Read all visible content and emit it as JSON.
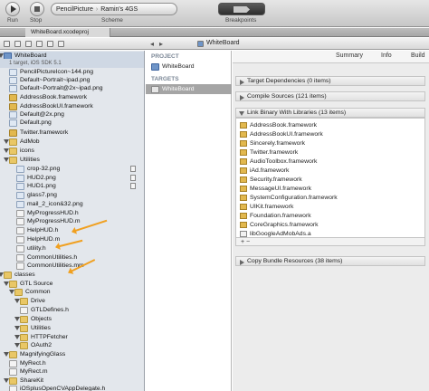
{
  "toolbar": {
    "run_label": "Run",
    "stop_label": "Stop",
    "scheme_target": "PencilPicture",
    "scheme_device": "Ramin's 4GS",
    "scheme_label": "Scheme",
    "breakpoints_label": "Breakpoints"
  },
  "tab": {
    "title": "WhiteBoard.xcodeproj"
  },
  "jumpbar": {
    "crumb": "WhiteBoard"
  },
  "navigator": {
    "rows": [
      {
        "label": "WhiteBoard",
        "icon": "proj"
      },
      {
        "label": "1 target, iOS SDK 5.1",
        "icon": "none"
      },
      {
        "label": "PencilPictureIcon~144.png",
        "icon": "png"
      },
      {
        "label": "Default~Portrait~ipad.png",
        "icon": "png"
      },
      {
        "label": "Default~Portrait@2x~ipad.png",
        "icon": "png"
      },
      {
        "label": "AddressBook.framework",
        "icon": "fw"
      },
      {
        "label": "AddressBookUI.framework",
        "icon": "fw"
      },
      {
        "label": "Default@2x.png",
        "icon": "png"
      },
      {
        "label": "Default.png",
        "icon": "png"
      },
      {
        "label": "Twitter.framework",
        "icon": "fw"
      },
      {
        "label": "AdMob",
        "icon": "folder"
      },
      {
        "label": "icons",
        "icon": "folder"
      },
      {
        "label": "Utilities",
        "icon": "folder"
      },
      {
        "label": "crop-32.png",
        "icon": "png"
      },
      {
        "label": "HUD2.png",
        "icon": "png"
      },
      {
        "label": "HUD1.png",
        "icon": "png"
      },
      {
        "label": "glass7.png",
        "icon": "png"
      },
      {
        "label": "mail_2_icon&32.png",
        "icon": "png"
      },
      {
        "label": "MyProgressHUD.h",
        "icon": "h"
      },
      {
        "label": "MyProgressHUD.m",
        "icon": "m"
      },
      {
        "label": "HelpHUD.h",
        "icon": "h"
      },
      {
        "label": "HelpHUD.m",
        "icon": "m"
      },
      {
        "label": "utility.h",
        "icon": "h"
      },
      {
        "label": "CommonUtilities.h",
        "icon": "h"
      },
      {
        "label": "CommonUtilities.mm",
        "icon": "m"
      },
      {
        "label": "classes",
        "icon": "folder"
      },
      {
        "label": "GTL Source",
        "icon": "folder"
      },
      {
        "label": "Common",
        "icon": "folder"
      },
      {
        "label": "Drive",
        "icon": "folder"
      },
      {
        "label": "GTLDefines.h",
        "icon": "h"
      },
      {
        "label": "Objects",
        "icon": "folder"
      },
      {
        "label": "Utilities",
        "icon": "folder"
      },
      {
        "label": "HTTPFetcher",
        "icon": "folder"
      },
      {
        "label": "OAuth2",
        "icon": "folder"
      },
      {
        "label": "MagnifyingGlass",
        "icon": "folder"
      },
      {
        "label": "MyRect.h",
        "icon": "h"
      },
      {
        "label": "MyRect.m",
        "icon": "m"
      },
      {
        "label": "ShareKit",
        "icon": "folder"
      },
      {
        "label": "iOSplusOpenCVAppDelegate.h",
        "icon": "h"
      }
    ]
  },
  "project_column": {
    "project_header": "PROJECT",
    "project_item": "WhiteBoard",
    "targets_header": "TARGETS",
    "target_item": "WhiteBoard"
  },
  "editor": {
    "tabs": [
      "Summary",
      "Info",
      "Build"
    ],
    "phases": {
      "target_deps": "Target Dependencies (0 items)",
      "compile": "Compile Sources (121 items)",
      "link": "Link Binary With Libraries (13 items)",
      "copy": "Copy Bundle Resources (38 items)"
    },
    "libraries": [
      "AddressBook.framework",
      "AddressBookUI.framework",
      "Sincerely.framework",
      "Twitter.framework",
      "AudioToolbox.framework",
      "iAd.framework",
      "Security.framework",
      "MessageUI.framework",
      "SystemConfiguration.framework",
      "UIKit.framework",
      "Foundation.framework",
      "CoreGraphics.framework",
      "libGoogleAdMobAds.a"
    ],
    "footer_controls": "+   −"
  },
  "colors": {
    "selection": "#cfd8e4",
    "annotation_arrow": "#f0a020",
    "folder": "#e9c766"
  }
}
